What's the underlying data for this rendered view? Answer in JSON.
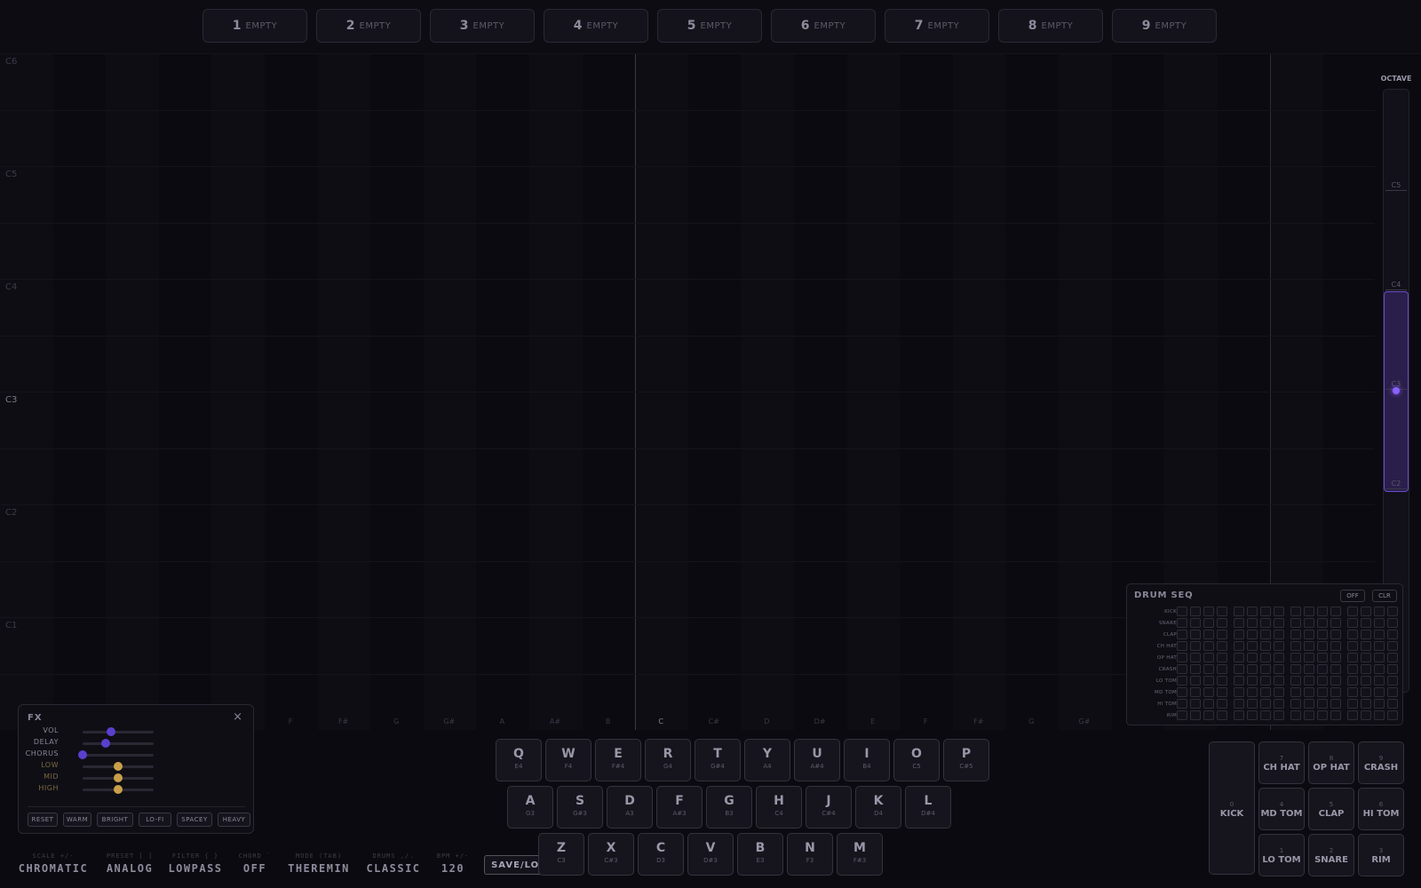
{
  "slots": [
    {
      "num": "1",
      "label": "EMPTY"
    },
    {
      "num": "2",
      "label": "EMPTY"
    },
    {
      "num": "3",
      "label": "EMPTY"
    },
    {
      "num": "4",
      "label": "EMPTY"
    },
    {
      "num": "5",
      "label": "EMPTY"
    },
    {
      "num": "6",
      "label": "EMPTY"
    },
    {
      "num": "7",
      "label": "EMPTY"
    },
    {
      "num": "8",
      "label": "EMPTY"
    },
    {
      "num": "9",
      "label": "EMPTY"
    }
  ],
  "grid": {
    "octave_labels": [
      "C6",
      "C5",
      "C4",
      "C3",
      "C2",
      "C1"
    ],
    "note_labels": [
      "F",
      "F#",
      "G",
      "G#",
      "A",
      "A#",
      "B",
      "C",
      "C#",
      "D",
      "D#",
      "E",
      "F",
      "F#",
      "G",
      "G#"
    ]
  },
  "octave": {
    "title": "OCTAVE",
    "labels": [
      "C5",
      "C4",
      "C3",
      "C2"
    ]
  },
  "fx": {
    "title": "FX",
    "close": "×",
    "sliders": [
      {
        "label": "VOL",
        "value": 0.4,
        "eq": false
      },
      {
        "label": "DELAY",
        "value": 0.32,
        "eq": false
      },
      {
        "label": "CHORUS",
        "value": 0.0,
        "eq": false
      },
      {
        "label": "LOW",
        "value": 0.5,
        "eq": true
      },
      {
        "label": "MID",
        "value": 0.5,
        "eq": true
      },
      {
        "label": "HIGH",
        "value": 0.5,
        "eq": true
      }
    ],
    "presets": [
      "RESET",
      "WARM",
      "BRIGHT",
      "LO-FI",
      "SPACEY",
      "HEAVY"
    ]
  },
  "keys": {
    "row1": [
      {
        "k": "Q",
        "n": "E4"
      },
      {
        "k": "W",
        "n": "F4"
      },
      {
        "k": "E",
        "n": "F#4"
      },
      {
        "k": "R",
        "n": "G4"
      },
      {
        "k": "T",
        "n": "G#4"
      },
      {
        "k": "Y",
        "n": "A4"
      },
      {
        "k": "U",
        "n": "A#4"
      },
      {
        "k": "I",
        "n": "B4"
      },
      {
        "k": "O",
        "n": "C5"
      },
      {
        "k": "P",
        "n": "C#5"
      }
    ],
    "row2": [
      {
        "k": "A",
        "n": "G3"
      },
      {
        "k": "S",
        "n": "G#3"
      },
      {
        "k": "D",
        "n": "A3"
      },
      {
        "k": "F",
        "n": "A#3"
      },
      {
        "k": "G",
        "n": "B3"
      },
      {
        "k": "H",
        "n": "C4"
      },
      {
        "k": "J",
        "n": "C#4"
      },
      {
        "k": "K",
        "n": "D4"
      },
      {
        "k": "L",
        "n": "D#4"
      }
    ],
    "row3": [
      {
        "k": "Z",
        "n": "C3"
      },
      {
        "k": "X",
        "n": "C#3"
      },
      {
        "k": "C",
        "n": "D3"
      },
      {
        "k": "V",
        "n": "D#3"
      },
      {
        "k": "B",
        "n": "E3"
      },
      {
        "k": "N",
        "n": "F3"
      },
      {
        "k": "M",
        "n": "F#3"
      }
    ]
  },
  "drumseq": {
    "title": "DRUM SEQ",
    "off": "OFF",
    "clr": "CLR",
    "rows": [
      "KICK",
      "SNARE",
      "CLAP",
      "CH HAT",
      "OP HAT",
      "CRASH",
      "LO TOM",
      "MD TOM",
      "HI TOM",
      "RIM"
    ]
  },
  "pads": [
    {
      "n": "0",
      "l": "KICK"
    },
    {
      "n": "7",
      "l": "CH HAT"
    },
    {
      "n": "8",
      "l": "OP HAT"
    },
    {
      "n": "9",
      "l": "CRASH"
    },
    {
      "n": "4",
      "l": "MD TOM"
    },
    {
      "n": "5",
      "l": "CLAP"
    },
    {
      "n": "6",
      "l": "HI TOM"
    },
    {
      "n": "1",
      "l": "LO TOM"
    },
    {
      "n": "2",
      "l": "SNARE"
    },
    {
      "n": "3",
      "l": "RIM"
    }
  ],
  "status": [
    {
      "label": "SCALE +/-",
      "value": "CHROMATIC"
    },
    {
      "label": "PRESET [ ]",
      "value": "ANALOG"
    },
    {
      "label": "FILTER { }",
      "value": "LOWPASS"
    },
    {
      "label": "CHORD `",
      "value": "OFF"
    },
    {
      "label": "MODE (TAB)",
      "value": "THEREMIN"
    },
    {
      "label": "DRUMS ,/.",
      "value": "CLASSIC"
    },
    {
      "label": "BPM +/-",
      "value": "120"
    }
  ],
  "save_load": "SAVE/LOAD"
}
